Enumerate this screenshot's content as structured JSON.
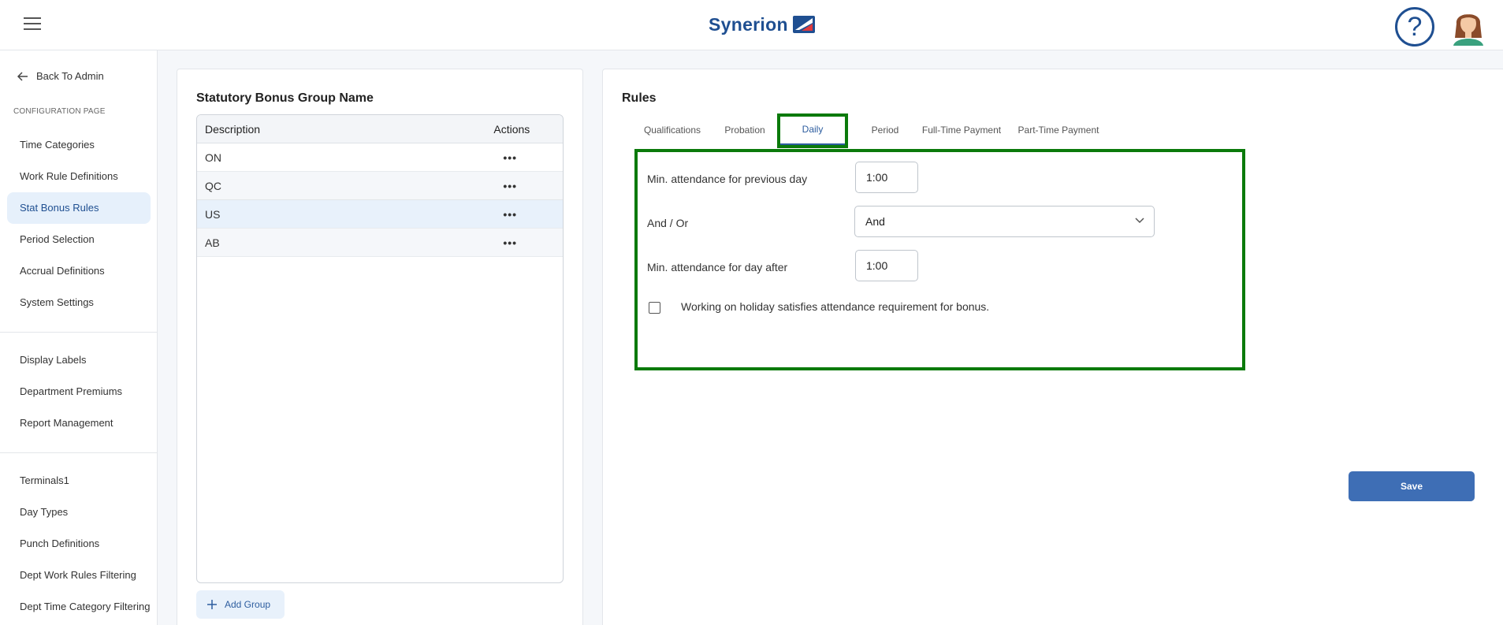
{
  "header": {
    "menu_icon": "hamburger-icon",
    "logo_text": "Synerion",
    "logo_mark": "synerion-flag-logo",
    "help_icon": "question-mark-icon",
    "help_glyph": "?",
    "avatar_icon": "user-avatar"
  },
  "sidebar": {
    "back_label": "Back To Admin",
    "back_icon": "arrow-left-icon",
    "section_label": "CONFIGURATION PAGE",
    "group1": [
      "Time Categories",
      "Work Rule Definitions",
      "Stat Bonus Rules",
      "Period Selection",
      "Accrual Definitions",
      "System Settings"
    ],
    "group2": [
      "Display Labels",
      "Department Premiums",
      "Report Management"
    ],
    "group3": [
      "Terminals1",
      "Day Types",
      "Punch Definitions",
      "Dept Work Rules Filtering",
      "Dept Time Category Filtering"
    ],
    "active_item": "Stat Bonus Rules"
  },
  "groups_panel": {
    "title": "Statutory Bonus Group Name",
    "columns": [
      "Description",
      "Actions"
    ],
    "rows": [
      {
        "description": "ON",
        "actions": "•••"
      },
      {
        "description": "QC",
        "actions": "•••"
      },
      {
        "description": "US",
        "actions": "•••"
      },
      {
        "description": "AB",
        "actions": "•••"
      }
    ],
    "selected_row": "US",
    "add_button": "Add Group",
    "add_icon": "plus-icon"
  },
  "rules_panel": {
    "title": "Rules",
    "tabs": [
      "Qualifications",
      "Probation",
      "Daily",
      "Period",
      "Full-Time Payment",
      "Part-Time Payment"
    ],
    "active_tab": "Daily",
    "fields": {
      "min_prev_label": "Min. attendance for previous day",
      "min_prev_value": "1:00",
      "andor_label": "And / Or",
      "andor_value": "And",
      "min_after_label": "Min. attendance for day after",
      "min_after_value": "1:00",
      "holiday_label": "Working on holiday satisfies attendance requirement for bonus.",
      "holiday_checked": false
    },
    "save_button": "Save"
  },
  "colors": {
    "brand_blue": "#1f4f91",
    "save_blue": "#3e6eb5",
    "highlight_green": "#0b7a0b",
    "active_nav_bg": "#e6f0fb"
  }
}
